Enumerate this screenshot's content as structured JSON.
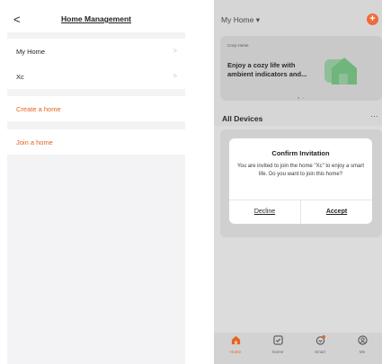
{
  "left_screen": {
    "header": {
      "title": "Home Management",
      "back_glyph": "<"
    },
    "homes": [
      {
        "label": "My Home",
        "chevron": ">"
      },
      {
        "label": "Xc",
        "chevron": ">"
      }
    ],
    "actions": {
      "create": "Create a home",
      "join": "Join a home"
    }
  },
  "right_screen": {
    "home_selector": "My Home ▾",
    "add_glyph": "+",
    "banner": {
      "small_label": "Cozy Home",
      "text": "Enjoy a cozy life with ambient indicators and...",
      "dots": "● •"
    },
    "section_title": "All Devices",
    "more_glyph": "···",
    "dialog": {
      "title": "Confirm Invitation",
      "message": "You are invited to join the home \"Xc\" to enjoy a smart life. Do you want to join this home?",
      "decline": "Decline",
      "accept": "Accept"
    },
    "tabs": [
      {
        "label": "Home",
        "icon": "home-icon",
        "active": true
      },
      {
        "label": "Scene",
        "icon": "scene-icon",
        "active": false
      },
      {
        "label": "Smart",
        "icon": "smart-icon",
        "active": false
      },
      {
        "label": "Me",
        "icon": "me-icon",
        "active": false
      }
    ]
  },
  "colors": {
    "accent": "#e5641f",
    "add_button": "#ef6b3a",
    "banner_art": "#6fb57c",
    "overlay": "#d6d6d6"
  }
}
